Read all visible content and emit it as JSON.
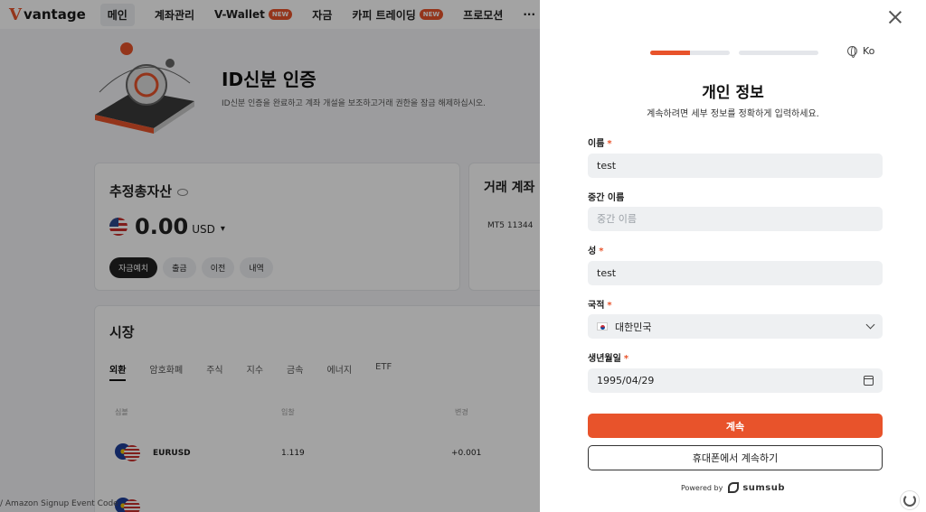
{
  "app": {
    "logo_text": "vantage",
    "nav": {
      "items": [
        {
          "label": "메인",
          "active": true
        },
        {
          "label": "계좌관리"
        },
        {
          "label": "V-Wallet",
          "badge": "NEW"
        },
        {
          "label": "자금"
        },
        {
          "label": "카피 트레이딩",
          "badge": "NEW"
        },
        {
          "label": "프로모션"
        },
        {
          "label": "···"
        }
      ]
    },
    "hero": {
      "title": "ID신분 인증",
      "description": "ID신분 인증을 완료하고 계좌 개설을 보조하고거래 권한을 잠금 해제하십시오."
    },
    "assets": {
      "title": "추정총자산",
      "amount": "0.00",
      "currency": "USD",
      "actions": [
        "자금예치",
        "출금",
        "이전",
        "내역"
      ]
    },
    "trade": {
      "title": "거래 계좌",
      "account": "MT5  11344"
    },
    "market": {
      "title": "시장",
      "tabs": [
        "외환",
        "암호화폐",
        "주식",
        "지수",
        "금속",
        "에너지",
        "ETF"
      ],
      "columns": [
        "심볼",
        "입찰",
        "변경"
      ],
      "rows": [
        {
          "symbol": "EURUSD",
          "bid": "1.119",
          "change": "+0.001"
        }
      ]
    },
    "bottom_note": "/ Amazon Signup Event Code"
  },
  "modal": {
    "lang": "Ko",
    "progress": [
      0.5,
      0
    ],
    "title": "개인 정보",
    "subtitle": "계속하려면 세부 정보를 정확하게 입력하세요.",
    "fields": {
      "first_name": {
        "label": "이름",
        "required": "*",
        "value": "test"
      },
      "middle_name": {
        "label": "중간 이름",
        "placeholder": "중간 이름",
        "value": ""
      },
      "last_name": {
        "label": "성",
        "required": "*",
        "value": "test"
      },
      "nationality": {
        "label": "국적",
        "required": "*",
        "value": "대한민국"
      },
      "birthdate": {
        "label": "생년월일",
        "required": "*",
        "value": "1995/04/29"
      }
    },
    "continue_label": "계속",
    "phone_label": "휴대폰에서 계속하기",
    "powered_by": "Powered by",
    "brand": "sumsub"
  },
  "colors": {
    "accent": "#e8532b",
    "overlay": "rgba(0,0,0,0.36)"
  }
}
